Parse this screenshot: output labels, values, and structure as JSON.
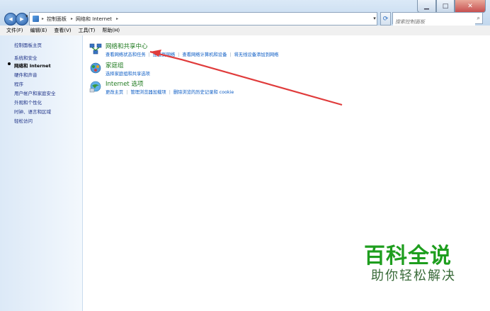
{
  "window": {
    "controls": {
      "min": "▁",
      "max": "□",
      "close": "✕"
    },
    "nav": {
      "back_icon": "◀",
      "forward_icon": "▶",
      "dropdown": "▾"
    }
  },
  "address": {
    "items": [
      "控制面板",
      "网络和 Internet"
    ],
    "separator": "▸",
    "dropdown": "▾",
    "refresh_icon": "⟳"
  },
  "search": {
    "placeholder": "搜索控制面板",
    "icon": "⌕"
  },
  "menubar": [
    "文件(F)",
    "编辑(E)",
    "查看(V)",
    "工具(T)",
    "帮助(H)"
  ],
  "sidebar": {
    "home": "控制面板主页",
    "items": [
      "系统和安全",
      "网络和 Internet",
      "硬件和声音",
      "程序",
      "用户帐户和家庭安全",
      "外观和个性化",
      "时钟、语言和区域",
      "轻松访问"
    ],
    "active_index": 1
  },
  "categories": [
    {
      "title": "网络和共享中心",
      "links": [
        "查看网络状态和任务",
        "连接到网络",
        "查看网络计算机和设备",
        "将无线设备添加到网络"
      ],
      "icon": "network-center-icon"
    },
    {
      "title": "家庭组",
      "links": [
        "选择家庭组和共享选项"
      ],
      "icon": "homegroup-icon"
    },
    {
      "title": "Internet 选项",
      "links": [
        "更改主页",
        "管理浏览器加载项",
        "删除浏览的历史记录和 cookie"
      ],
      "icon": "internet-options-icon"
    }
  ],
  "watermark": {
    "main": "百科全说",
    "sub": "助你轻松解决"
  },
  "colors": {
    "link": "#0a5bc4",
    "category_title": "#1f7a1f",
    "arrow": "#e03b3b",
    "watermark": "#1e9e1e"
  }
}
